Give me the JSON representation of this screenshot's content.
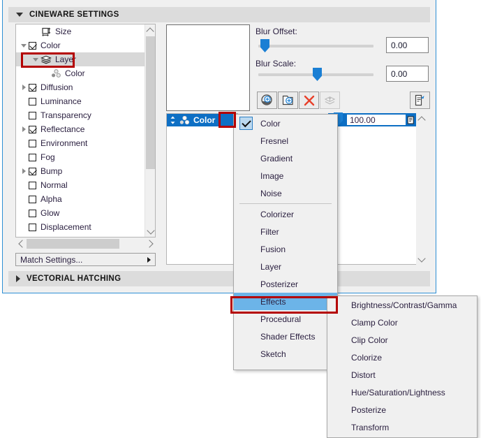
{
  "panel": {
    "sections": [
      {
        "id": "cineware",
        "title": "CINEWARE SETTINGS",
        "state": "expanded",
        "arrow": "triangle-down-icon"
      },
      {
        "id": "vectorial",
        "title": "VECTORIAL HATCHING",
        "state": "collapsed",
        "arrow": "triangle-right-icon"
      }
    ]
  },
  "tree": {
    "items": [
      {
        "label": "Size",
        "indent": 1,
        "expander": "none",
        "checkbox": "none",
        "icon": "size-icon",
        "selected": false
      },
      {
        "label": "Color",
        "indent": 0,
        "expander": "down",
        "checkbox": "checked",
        "icon": "none",
        "selected": false
      },
      {
        "label": "Layer",
        "indent": 1,
        "expander": "down",
        "checkbox": "none",
        "icon": "layer-icon",
        "selected": true
      },
      {
        "label": "Color",
        "indent": 2,
        "expander": "none",
        "checkbox": "none",
        "icon": "shader-icon",
        "selected": false
      },
      {
        "label": "Diffusion",
        "indent": 0,
        "expander": "right",
        "checkbox": "checked",
        "icon": "none",
        "selected": false
      },
      {
        "label": "Luminance",
        "indent": 0,
        "expander": "none",
        "checkbox": "empty",
        "icon": "none",
        "selected": false
      },
      {
        "label": "Transparency",
        "indent": 0,
        "expander": "none",
        "checkbox": "empty",
        "icon": "none",
        "selected": false
      },
      {
        "label": "Reflectance",
        "indent": 0,
        "expander": "right",
        "checkbox": "checked",
        "icon": "none",
        "selected": false
      },
      {
        "label": "Environment",
        "indent": 0,
        "expander": "none",
        "checkbox": "empty",
        "icon": "none",
        "selected": false
      },
      {
        "label": "Fog",
        "indent": 0,
        "expander": "none",
        "checkbox": "empty",
        "icon": "none",
        "selected": false
      },
      {
        "label": "Bump",
        "indent": 0,
        "expander": "right",
        "checkbox": "checked",
        "icon": "none",
        "selected": false
      },
      {
        "label": "Normal",
        "indent": 0,
        "expander": "none",
        "checkbox": "empty",
        "icon": "none",
        "selected": false
      },
      {
        "label": "Alpha",
        "indent": 0,
        "expander": "none",
        "checkbox": "empty",
        "icon": "none",
        "selected": false
      },
      {
        "label": "Glow",
        "indent": 0,
        "expander": "none",
        "checkbox": "empty",
        "icon": "none",
        "selected": false
      },
      {
        "label": "Displacement",
        "indent": 0,
        "expander": "none",
        "checkbox": "empty",
        "icon": "none",
        "selected": false
      }
    ],
    "match_settings_label": "Match Settings..."
  },
  "editor": {
    "blur_offset_label": "Blur Offset:",
    "blur_offset_value": "0.00",
    "blur_offset_pos_pct": 3,
    "blur_scale_label": "Blur Scale:",
    "blur_scale_value": "0.00",
    "blur_scale_pos_pct": 50,
    "tools": [
      {
        "name": "add-shader-icon",
        "enabled": true
      },
      {
        "name": "add-layer-icon",
        "enabled": true
      },
      {
        "name": "delete-icon",
        "enabled": true
      },
      {
        "name": "merge-layers-icon",
        "enabled": false
      }
    ],
    "export_tool": {
      "name": "export-icon",
      "enabled": true
    }
  },
  "shader_list": {
    "rows": [
      {
        "label": "Color",
        "selected": true,
        "icon": "shader-icon",
        "value": "100.00"
      }
    ]
  },
  "context_menu": {
    "items": [
      {
        "label": "Color",
        "checked": true,
        "submenu": false,
        "separator_after": false,
        "highlighted": false
      },
      {
        "label": "Fresnel",
        "checked": false,
        "submenu": false,
        "separator_after": false,
        "highlighted": false
      },
      {
        "label": "Gradient",
        "checked": false,
        "submenu": false,
        "separator_after": false,
        "highlighted": false
      },
      {
        "label": "Image",
        "checked": false,
        "submenu": false,
        "separator_after": false,
        "highlighted": false
      },
      {
        "label": "Noise",
        "checked": false,
        "submenu": false,
        "separator_after": true,
        "highlighted": false
      },
      {
        "label": "Colorizer",
        "checked": false,
        "submenu": false,
        "separator_after": false,
        "highlighted": false
      },
      {
        "label": "Filter",
        "checked": false,
        "submenu": false,
        "separator_after": false,
        "highlighted": false
      },
      {
        "label": "Fusion",
        "checked": false,
        "submenu": false,
        "separator_after": false,
        "highlighted": false
      },
      {
        "label": "Layer",
        "checked": false,
        "submenu": false,
        "separator_after": false,
        "highlighted": false
      },
      {
        "label": "Posterizer",
        "checked": false,
        "submenu": false,
        "separator_after": false,
        "highlighted": false
      },
      {
        "label": "Effects",
        "checked": false,
        "submenu": true,
        "separator_after": false,
        "highlighted": true
      },
      {
        "label": "Procedural",
        "checked": false,
        "submenu": true,
        "separator_after": false,
        "highlighted": false
      },
      {
        "label": "Shader Effects",
        "checked": false,
        "submenu": true,
        "separator_after": false,
        "highlighted": false
      },
      {
        "label": "Sketch",
        "checked": false,
        "submenu": true,
        "separator_after": false,
        "highlighted": false
      }
    ]
  },
  "submenu": {
    "items": [
      {
        "label": "Brightness/Contrast/Gamma"
      },
      {
        "label": "Clamp Color"
      },
      {
        "label": "Clip Color"
      },
      {
        "label": "Colorize"
      },
      {
        "label": "Distort"
      },
      {
        "label": "Hue/Saturation/Lightness"
      },
      {
        "label": "Posterize"
      },
      {
        "label": "Transform"
      }
    ]
  },
  "colors": {
    "accent_blue": "#0d6fc4",
    "highlight_blue": "#6cb4e8",
    "annotation_red": "#b40000",
    "panel_bg": "#f0f0f0",
    "header_bg": "#dcdcdc",
    "text": "#2b2040"
  }
}
